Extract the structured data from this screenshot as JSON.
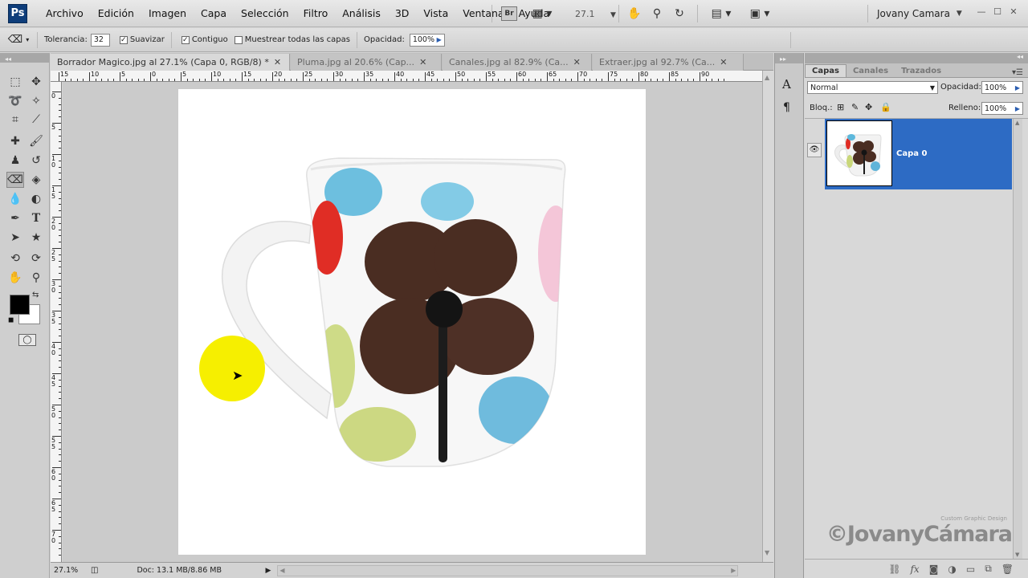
{
  "app": {
    "logo_text": "Ps",
    "menu": [
      "Archivo",
      "Edición",
      "Imagen",
      "Capa",
      "Selección",
      "Filtro",
      "Análisis",
      "3D",
      "Vista",
      "Ventana",
      "Ayuda"
    ],
    "bridge_label": "Br",
    "zoom_level": "27.1",
    "user": "Jovany Camara",
    "window_controls": {
      "minimize": "—",
      "maximize": "☐",
      "close": "✕"
    }
  },
  "options": {
    "tolerance_label": "Tolerancia:",
    "tolerance_value": "32",
    "antialias_label": "Suavizar",
    "contiguous_label": "Contiguo",
    "sample_all_label": "Muestrear todas las capas",
    "opacity_label": "Opacidad:",
    "opacity_value": "100%"
  },
  "tabs": [
    {
      "label": "Borrador Magico.jpg al 27.1% (Capa 0, RGB/8) *",
      "active": true
    },
    {
      "label": "Pluma.jpg al 20.6% (Cap...",
      "active": false
    },
    {
      "label": "Canales.jpg al 82.9% (Ca...",
      "active": false
    },
    {
      "label": "Extraer.jpg al 92.7% (Ca...",
      "active": false
    }
  ],
  "ruler": {
    "top_labels": [
      "15",
      "10",
      "5",
      "0",
      "5",
      "10",
      "15",
      "20",
      "25",
      "30",
      "35",
      "40",
      "45",
      "50",
      "55",
      "60",
      "65",
      "70",
      "75",
      "80",
      "85",
      "90"
    ],
    "left_labels": [
      "0",
      "5",
      "1 0",
      "1 5",
      "2 0",
      "2 5",
      "3 0",
      "3 5",
      "4 0",
      "4 5",
      "5 0",
      "5 5",
      "6 0",
      "6 5",
      "7 0"
    ]
  },
  "status": {
    "zoom": "27.1%",
    "doc": "Doc: 13.1 MB/8.86 MB"
  },
  "layers_panel": {
    "tabs": [
      "Capas",
      "Canales",
      "Trazados"
    ],
    "blend_mode": "Normal",
    "opacity_label": "Opacidad:",
    "opacity_value": "100%",
    "lock_label": "Bloq.:",
    "fill_label": "Relleno:",
    "fill_value": "100%",
    "layer_name": "Capa 0"
  },
  "watermark": {
    "text": "©JovanyCámara",
    "tagline": "Custom Graphic Design"
  },
  "colors": {
    "foreground": "#000000",
    "background": "#ffffff",
    "layer_selected": "#2d6bc4",
    "cursor_highlight": "#f6ef00"
  }
}
